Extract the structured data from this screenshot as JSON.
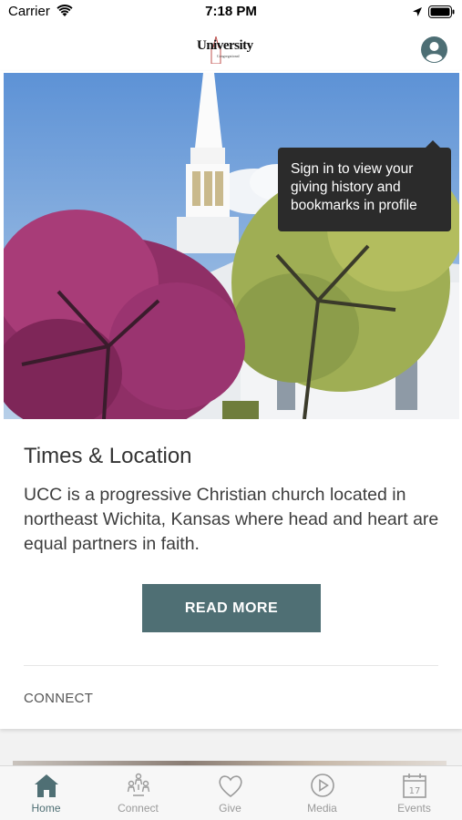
{
  "status_bar": {
    "carrier": "Carrier",
    "time": "7:18 PM"
  },
  "header": {
    "logo_text": "University",
    "logo_subtitle": "Congregational",
    "profile_icon": "person-icon"
  },
  "tooltip": {
    "text": "Sign in to view your giving history and bookmarks in profile"
  },
  "card": {
    "title": "Times & Location",
    "body": "UCC is a progressive Christian church located in northeast Wichita, Kansas where head and heart are equal partners in faith.",
    "button_label": "READ MORE",
    "section_label": "CONNECT"
  },
  "tabs": [
    {
      "label": "Home",
      "icon": "home-icon",
      "active": true
    },
    {
      "label": "Connect",
      "icon": "people-icon",
      "active": false
    },
    {
      "label": "Give",
      "icon": "heart-icon",
      "active": false
    },
    {
      "label": "Media",
      "icon": "play-icon",
      "active": false
    },
    {
      "label": "Events",
      "icon": "calendar-icon",
      "active": false
    }
  ],
  "colors": {
    "accent": "#4f6f74",
    "tooltip_bg": "#2b2b2b",
    "tab_inactive": "#9a9a9a"
  }
}
